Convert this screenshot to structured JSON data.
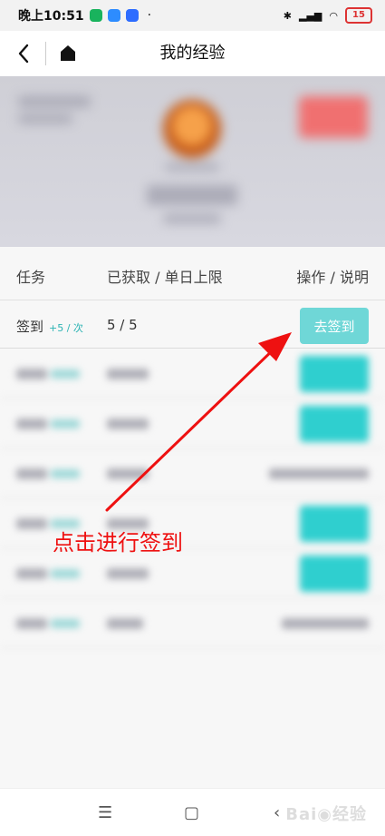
{
  "statusbar": {
    "time": "晚上10:51",
    "dot": "·",
    "battery": "15"
  },
  "topbar": {
    "title": "我的经验"
  },
  "table": {
    "headers": [
      "任务",
      "已获取 / 单日上限",
      "操作 / 说明"
    ],
    "rows": [
      {
        "task": "签到",
        "rate": "+5 / 次",
        "progress": "5 / 5",
        "action": "去签到"
      }
    ]
  },
  "annotation": {
    "text": "点击进行签到"
  },
  "colors": {
    "accent": "#6fd7d7",
    "annotation": "#ee1111"
  }
}
